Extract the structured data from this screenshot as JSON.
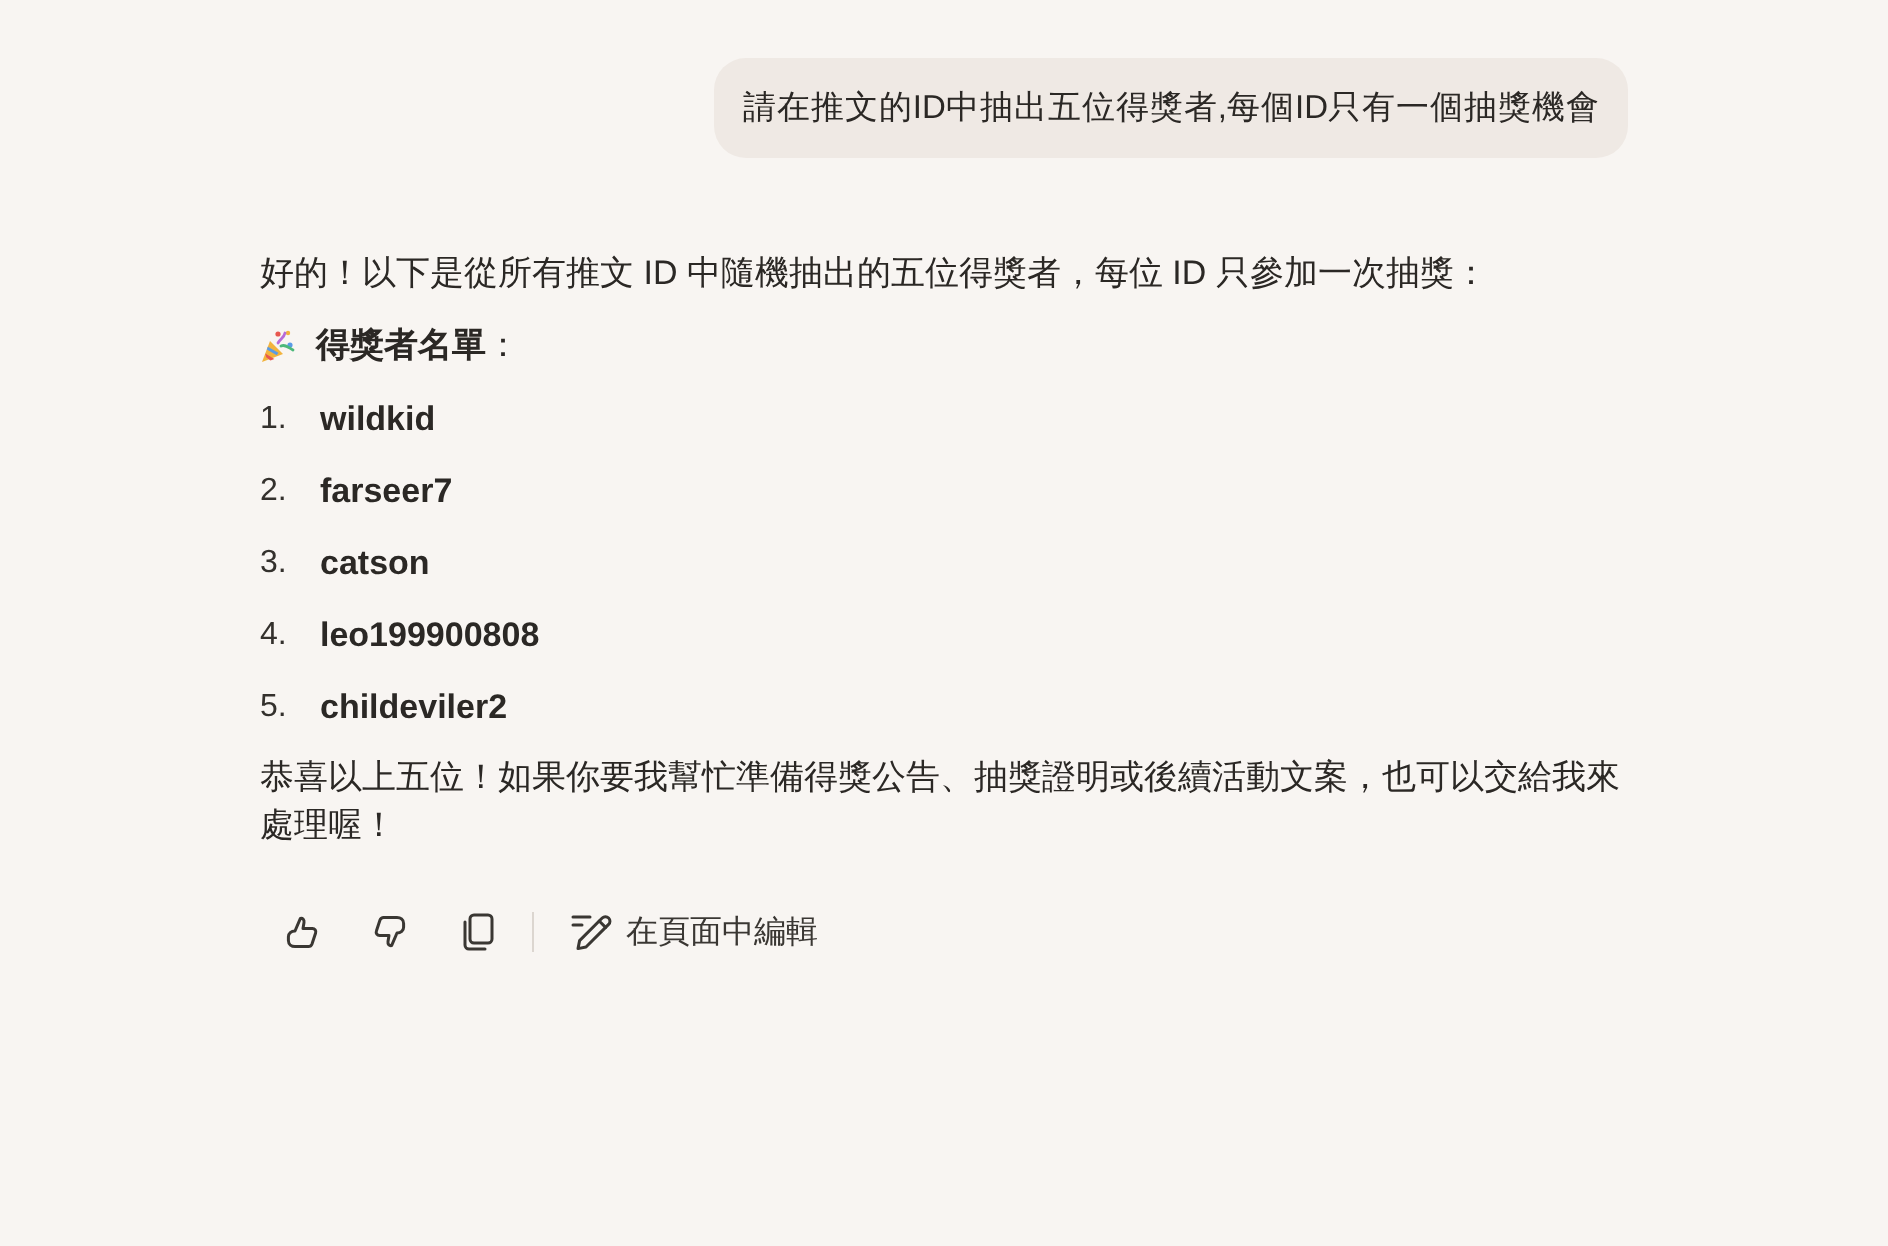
{
  "user_message": {
    "text": "請在推文的ID中抽出五位得獎者,每個ID只有一個抽獎機會"
  },
  "assistant_message": {
    "intro": "好的！以下是從所有推文 ID 中隨機抽出的五位得獎者，每位 ID 只參加一次抽獎：",
    "heading": "**得獎者名單**：",
    "winners": [
      {
        "number": "1.",
        "name": "wildkid"
      },
      {
        "number": "2.",
        "name": "farseer7"
      },
      {
        "number": "3.",
        "name": "catson"
      },
      {
        "number": "4.",
        "name": "leo199900808"
      },
      {
        "number": "5.",
        "name": "childeviler2"
      }
    ],
    "closing": "恭喜以上五位！如果你要我幫忙準備得獎公告、抽獎證明或後續活動文案，也可以交給我來處理喔！"
  },
  "actions": [
    {
      "kind": "thumbs_up"
    },
    {
      "kind": "thumbs_down"
    },
    {
      "kind": "copy"
    },
    {
      "kind": "edit",
      "label": "在頁面中編輯"
    }
  ]
}
